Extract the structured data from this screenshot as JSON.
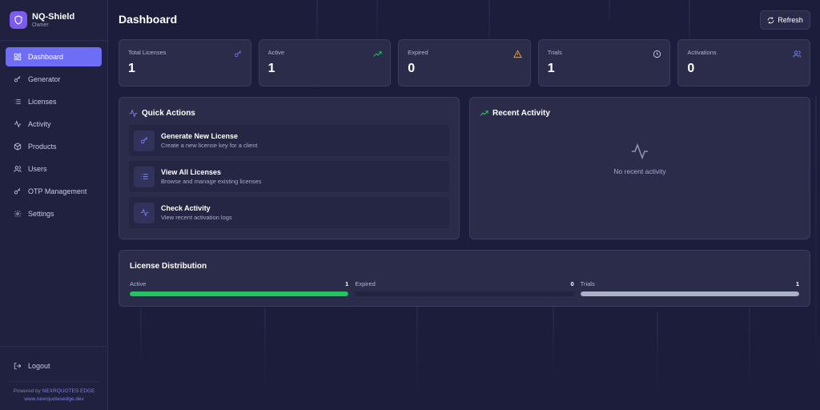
{
  "brand": {
    "title": "NQ-Shield",
    "subtitle": "Owner"
  },
  "nav": {
    "items": [
      {
        "label": "Dashboard",
        "icon": "grid-icon",
        "active": true
      },
      {
        "label": "Generator",
        "icon": "key-icon"
      },
      {
        "label": "Licenses",
        "icon": "list-icon"
      },
      {
        "label": "Activity",
        "icon": "activity-icon"
      },
      {
        "label": "Products",
        "icon": "box-icon"
      },
      {
        "label": "Users",
        "icon": "users-icon"
      },
      {
        "label": "OTP Management",
        "icon": "key-icon"
      },
      {
        "label": "Settings",
        "icon": "gear-icon"
      }
    ],
    "logout": "Logout"
  },
  "footer": {
    "powered_prefix": "Powered by ",
    "powered_brand": "NEXRQUOTES EDGE",
    "url": "www.nexrquotesedge.dev"
  },
  "header": {
    "title": "Dashboard",
    "refresh_label": "Refresh"
  },
  "stats": [
    {
      "label": "Total Licenses",
      "value": "1",
      "icon": "key-icon",
      "color": "#6d6ef5"
    },
    {
      "label": "Active",
      "value": "1",
      "icon": "trending-up-icon",
      "color": "#22c55e"
    },
    {
      "label": "Expired",
      "value": "0",
      "icon": "warning-icon",
      "color": "#f5a524"
    },
    {
      "label": "Trials",
      "value": "1",
      "icon": "clock-icon",
      "color": "#c7c9e6"
    },
    {
      "label": "Activations",
      "value": "0",
      "icon": "users-icon",
      "color": "#7b7df5"
    }
  ],
  "quick_actions": {
    "title": "Quick Actions",
    "items": [
      {
        "title": "Generate New License",
        "desc": "Create a new license key for a client",
        "icon": "key-icon"
      },
      {
        "title": "View All Licenses",
        "desc": "Browse and manage existing licenses",
        "icon": "list-icon"
      },
      {
        "title": "Check Activity",
        "desc": "View recent activation logs",
        "icon": "activity-icon"
      }
    ]
  },
  "recent_activity": {
    "title": "Recent Activity",
    "empty_text": "No recent activity"
  },
  "distribution": {
    "title": "License Distribution",
    "items": [
      {
        "label": "Active",
        "count": "1",
        "fraction": 1.0,
        "color": "#22c55e"
      },
      {
        "label": "Expired",
        "count": "0",
        "fraction": 0.0,
        "color": "#ef4444"
      },
      {
        "label": "Trials",
        "count": "1",
        "fraction": 1.0,
        "color": "#aab0c8"
      }
    ]
  }
}
